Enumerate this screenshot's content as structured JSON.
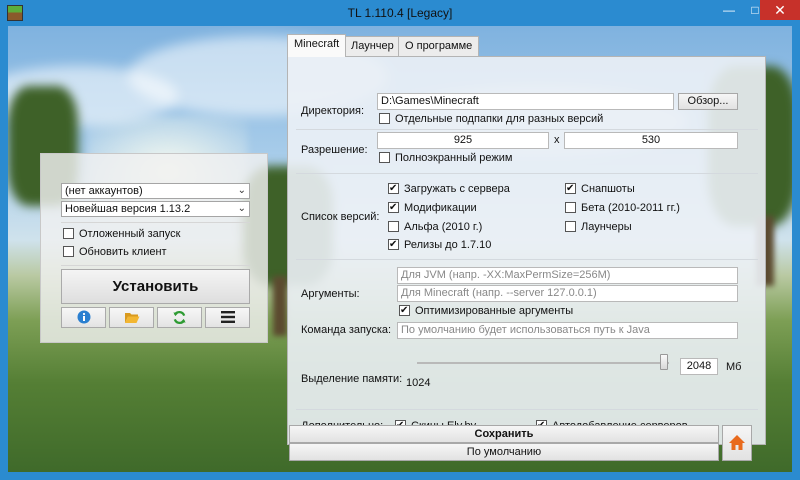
{
  "window": {
    "title": "TL 1.110.4 [Legacy]",
    "minimize_glyph": "—",
    "maximize_glyph": "□",
    "close_glyph": "✕"
  },
  "left_panel": {
    "account_select": "(нет аккаунтов)",
    "version_select": "Новейшая версия 1.13.2",
    "delayed_launch_label": "Отложенный запуск",
    "delayed_launch_checked": false,
    "update_client_label": "Обновить клиент",
    "update_client_checked": false,
    "install_button": "Установить",
    "icons": [
      "info-icon",
      "folder-icon",
      "refresh-icon",
      "menu-icon"
    ]
  },
  "tabs": [
    {
      "label": "Minecraft",
      "active": true
    },
    {
      "label": "Лаунчер",
      "active": false
    },
    {
      "label": "О программе",
      "active": false
    }
  ],
  "settings": {
    "directory_label": "Директория:",
    "directory_value": "D:\\Games\\Minecraft",
    "browse_button": "Обзор...",
    "separate_subfolders_label": "Отдельные подпапки для разных версий",
    "resolution_label": "Разрешение:",
    "width_value": "925",
    "x_separator": "x",
    "height_value": "530",
    "fullscreen_label": "Полноэкранный режим",
    "versions_label": "Список версий:",
    "versions": {
      "download_from_server": {
        "label": "Загружать с сервера",
        "checked": true
      },
      "modifications": {
        "label": "Модификации",
        "checked": true
      },
      "alpha": {
        "label": "Альфа (2010 г.)",
        "checked": false
      },
      "releases": {
        "label": "Релизы до 1.7.10",
        "checked": true
      },
      "snapshots": {
        "label": "Снапшоты",
        "checked": true
      },
      "beta": {
        "label": "Бета (2010-2011 гг.)",
        "checked": false
      },
      "launchers": {
        "label": "Лаунчеры",
        "checked": false
      }
    },
    "arguments_label": "Аргументы:",
    "jvm_placeholder": "Для JVM (напр. -XX:MaxPermSize=256M)",
    "minecraft_placeholder": "Для Minecraft (напр. --server 127.0.0.1)",
    "optimized_args_label": "Оптимизированные аргументы",
    "optimized_args_checked": true,
    "launch_command_label": "Команда запуска:",
    "launch_command_placeholder": "По умолчанию будет использоваться путь к Java",
    "memory_label": "Выделение памяти:",
    "memory_min": "1024",
    "memory_value": "2048",
    "memory_unit": "Мб",
    "memory_slider_fraction": 0.98,
    "extra_label": "Дополнительно:",
    "ely_skins_label": "Скины Ely.by",
    "ely_skins_checked": true,
    "auto_servers_label": "Автодобавление серверов",
    "auto_servers_checked": true,
    "save_button": "Сохранить",
    "default_button": "По умолчанию"
  }
}
